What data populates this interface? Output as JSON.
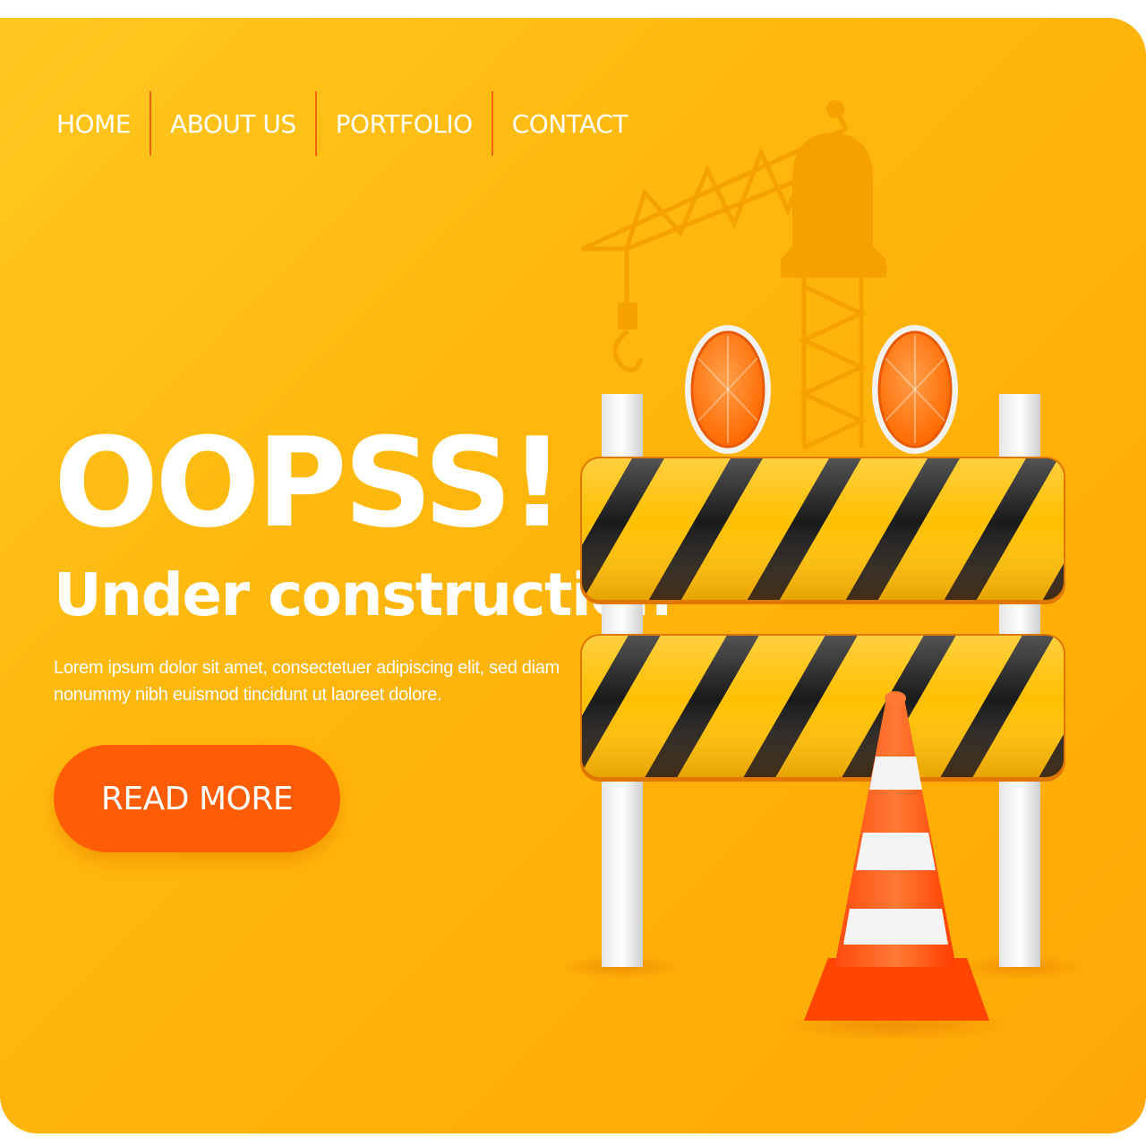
{
  "nav": {
    "items": [
      {
        "label": "HOME"
      },
      {
        "label": "ABOUT US"
      },
      {
        "label": "PORTFOLIO"
      },
      {
        "label": "CONTACT"
      }
    ]
  },
  "hero": {
    "headline": "OOPSS!",
    "subheadline": "Under construction",
    "body": "Lorem ipsum dolor sit amet, consectetuer adipiscing elit, sed diam nonummy nibh euismod tincidunt ut laoreet dolore.",
    "cta_label": "READ MORE"
  },
  "colors": {
    "background": "#ffb80a",
    "accent": "#ff5d05",
    "text": "#ffffff",
    "stripe_dark": "#1a1a1a",
    "stripe_light": "#ffc000"
  },
  "icons": {
    "crane": "crane-icon",
    "warning_lights": "warning-light-icon",
    "barrier": "road-barrier-icon",
    "cone": "traffic-cone-icon"
  }
}
